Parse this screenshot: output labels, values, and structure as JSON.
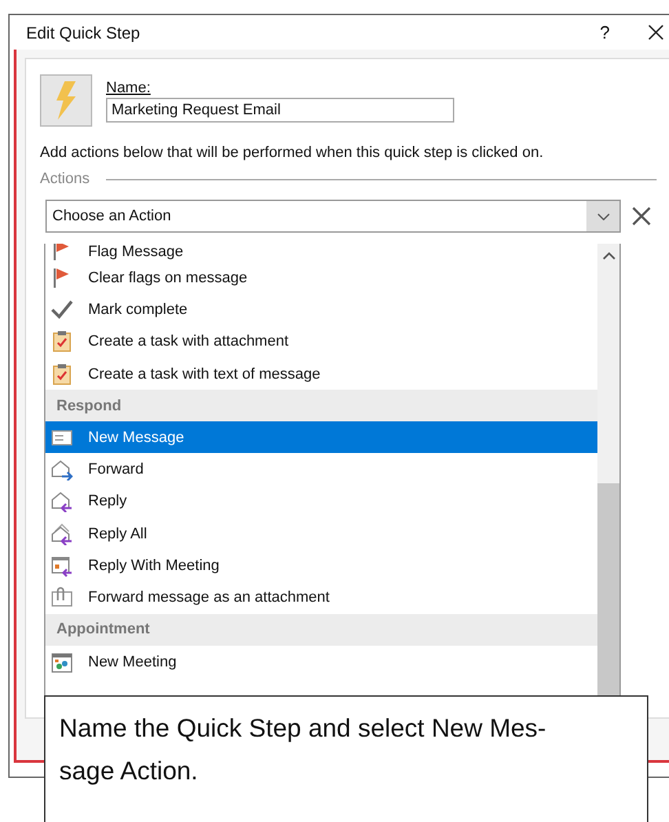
{
  "window": {
    "title": "Edit Quick Step",
    "help": "?"
  },
  "name_field": {
    "label": "Name:",
    "value": "Marketing Request Email"
  },
  "instructions": "Add actions below that will be performed when this quick step is clicked on.",
  "actions_group": {
    "label": "Actions"
  },
  "action_select": {
    "value": "Choose an Action"
  },
  "menu": {
    "items": [
      {
        "kind": "partial",
        "label": "Flag Message",
        "selected": false
      },
      {
        "kind": "item",
        "label": "Clear flags on message",
        "selected": false
      },
      {
        "kind": "item",
        "label": "Mark complete",
        "selected": false
      },
      {
        "kind": "item",
        "label": "Create a task with attachment",
        "selected": false
      },
      {
        "kind": "item",
        "label": "Create a task with text of message",
        "selected": false
      },
      {
        "kind": "header",
        "label": "Respond"
      },
      {
        "kind": "item",
        "label": "New Message",
        "selected": true
      },
      {
        "kind": "item",
        "label": "Forward",
        "selected": false
      },
      {
        "kind": "item",
        "label": "Reply",
        "selected": false
      },
      {
        "kind": "item",
        "label": "Reply All",
        "selected": false
      },
      {
        "kind": "item",
        "label": "Reply With Meeting",
        "selected": false
      },
      {
        "kind": "item",
        "label": "Forward message as an attachment",
        "selected": false
      },
      {
        "kind": "header",
        "label": "Appointment"
      },
      {
        "kind": "item",
        "label": "New Meeting",
        "selected": false
      }
    ]
  },
  "caption": {
    "lines": [
      "Name the Quick Step and select New Mes-",
      "sage Action."
    ]
  }
}
